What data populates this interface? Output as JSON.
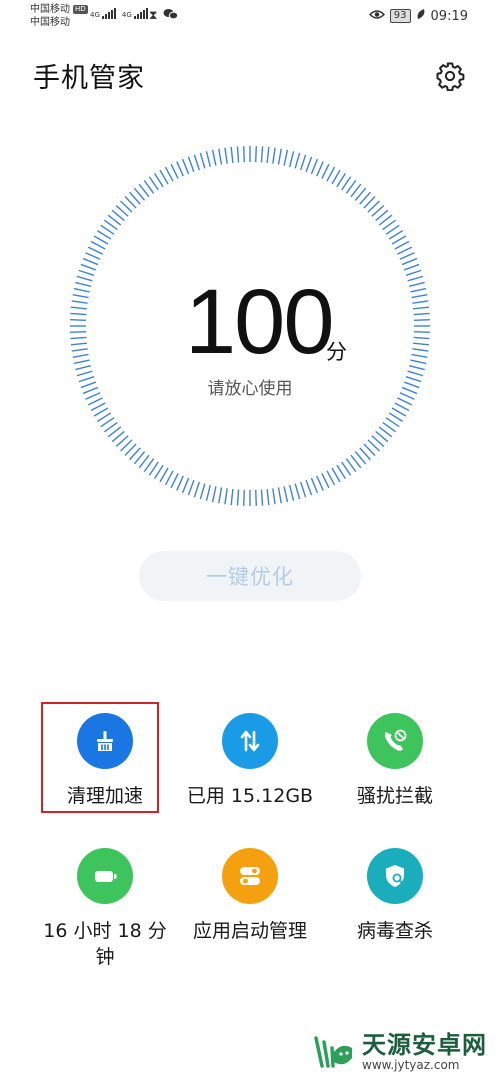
{
  "status_bar": {
    "carrier_1": "中国移动",
    "carrier_1_badge": "HD",
    "carrier_2": "中国移动",
    "network_1": "4G",
    "network_2": "4G",
    "battery_level": "93",
    "time": "09:19"
  },
  "header": {
    "title": "手机管家"
  },
  "score": {
    "value": "100",
    "unit": "分",
    "description": "请放心使用"
  },
  "optimize_button": {
    "label": "一键优化"
  },
  "tools": [
    {
      "label": "清理加速",
      "icon": "broom-icon",
      "color": "#1a76e3"
    },
    {
      "label": "已用 15.12GB",
      "icon": "transfer-arrows-icon",
      "color": "#1a9be8"
    },
    {
      "label": "骚扰拦截",
      "icon": "blocked-call-icon",
      "color": "#3dc45c"
    },
    {
      "label": "16 小时 18 分钟",
      "icon": "battery-icon",
      "color": "#3dc45c"
    },
    {
      "label": "应用启动管理",
      "icon": "toggle-switch-icon",
      "color": "#f5a00e"
    },
    {
      "label": "病毒查杀",
      "icon": "shield-search-icon",
      "color": "#1aaebc"
    }
  ],
  "watermark": {
    "title": "天源安卓网",
    "url": "www.jytyaz.com"
  },
  "colors": {
    "dial_tick": "#3d82d3",
    "highlight_border": "#d0242a",
    "optimize_text": "#b3cce8"
  }
}
